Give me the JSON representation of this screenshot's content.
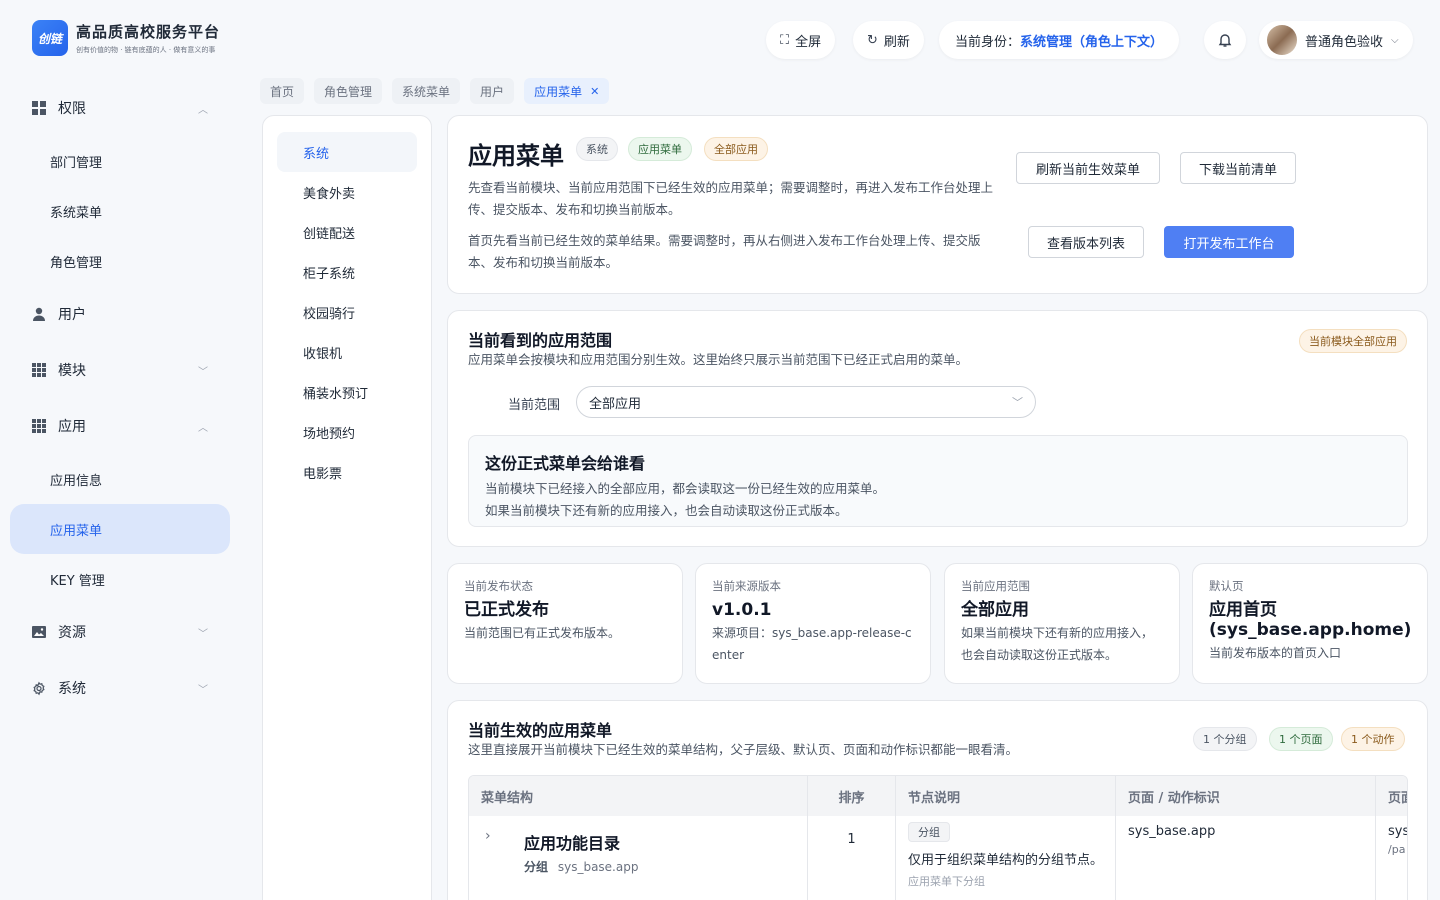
{
  "logo": {
    "mark": "创链",
    "title": "高品质高校服务平台",
    "subtitle": "创有价值的物 · 链有底蕴的人 · 做有意义的事"
  },
  "header": {
    "fullscreen": "全屏",
    "refresh": "刷新",
    "identity_label": "当前身份：",
    "identity_value": "系统管理（角色上下文）",
    "user_name": "普通角色验收"
  },
  "sidebar": {
    "groups": [
      {
        "label": "权限",
        "icon": "grid-icon",
        "expanded": true,
        "items": [
          "部门管理",
          "系统菜单",
          "角色管理"
        ]
      },
      {
        "label": "用户",
        "icon": "user-icon"
      },
      {
        "label": "模块",
        "icon": "apps-icon",
        "expanded": false
      },
      {
        "label": "应用",
        "icon": "apps-icon",
        "expanded": true,
        "items": [
          "应用信息",
          "应用菜单",
          "KEY 管理"
        ],
        "active_item": "应用菜单"
      },
      {
        "label": "资源",
        "icon": "image-icon",
        "expanded": false
      },
      {
        "label": "系统",
        "icon": "gear-icon",
        "expanded": false
      }
    ]
  },
  "tabs": [
    "首页",
    "角色管理",
    "系统菜单",
    "用户",
    "应用菜单"
  ],
  "active_tab": "应用菜单",
  "left_panel": {
    "items": [
      "系统",
      "美食外卖",
      "创链配送",
      "柜子系统",
      "校园骑行",
      "收银机",
      "桶装水预订",
      "场地预约",
      "电影票"
    ],
    "active": "系统"
  },
  "hero": {
    "title": "应用菜单",
    "tags": [
      "系统",
      "应用菜单",
      "全部应用"
    ],
    "desc1": "先查看当前模块、当前应用范围下已经生效的应用菜单；需要调整时，再进入发布工作台处理上传、提交版本、发布和切换当前版本。",
    "desc2": "首页先看当前已经生效的菜单结果。需要调整时，再从右侧进入发布工作台处理上传、提交版本、发布和切换当前版本。",
    "buttons": {
      "refresh": "刷新当前生效菜单",
      "download": "下载当前清单",
      "versions": "查看版本列表",
      "open": "打开发布工作台"
    }
  },
  "scope": {
    "title": "当前看到的应用范围",
    "desc": "应用菜单会按模块和应用范围分别生效。这里始终只展示当前范围下已经正式启用的菜单。",
    "badge": "当前模块全部应用",
    "label": "当前范围",
    "value": "全部应用",
    "notice_title": "这份正式菜单会给谁看",
    "notice_line1": "当前模块下已经接入的全部应用，都会读取这一份已经生效的应用菜单。",
    "notice_line2": "如果当前模块下还有新的应用接入，也会自动读取这份正式版本。"
  },
  "stats": [
    {
      "key": "当前发布状态",
      "value": "已正式发布",
      "desc": "当前范围已有正式发布版本。"
    },
    {
      "key": "当前来源版本",
      "value": "v1.0.1",
      "desc": "来源项目：sys_base.app-release-center"
    },
    {
      "key": "当前应用范围",
      "value": "全部应用",
      "desc": "如果当前模块下还有新的应用接入，也会自动读取这份正式版本。"
    },
    {
      "key": "默认页",
      "value": "应用首页 (sys_base.app.home)",
      "desc": "当前发布版本的首页入口"
    }
  ],
  "menu": {
    "title": "当前生效的应用菜单",
    "desc": "这里直接展开当前模块下已经生效的菜单结构，父子层级、默认页、页面和动作标识都能一眼看清。",
    "badges": [
      "1 个分组",
      "1 个页面",
      "1 个动作"
    ],
    "columns": [
      "菜单结构",
      "排序",
      "节点说明",
      "页面 / 动作标识",
      "页面"
    ],
    "row": {
      "name": "应用功能目录",
      "type": "分组",
      "code": "sys_base.app",
      "order": "1",
      "node_tag": "分组",
      "node_desc": "仅用于组织菜单结构的分组节点。",
      "node_extra": "应用菜单下分组",
      "ident": "sys_base.app",
      "page_col_1": "sys_",
      "page_col_2": "/pa"
    }
  },
  "colors": {
    "accent": "#2563eb",
    "primary_button": "#4f7ff3",
    "active_nav_bg": "#dbe6fb"
  }
}
